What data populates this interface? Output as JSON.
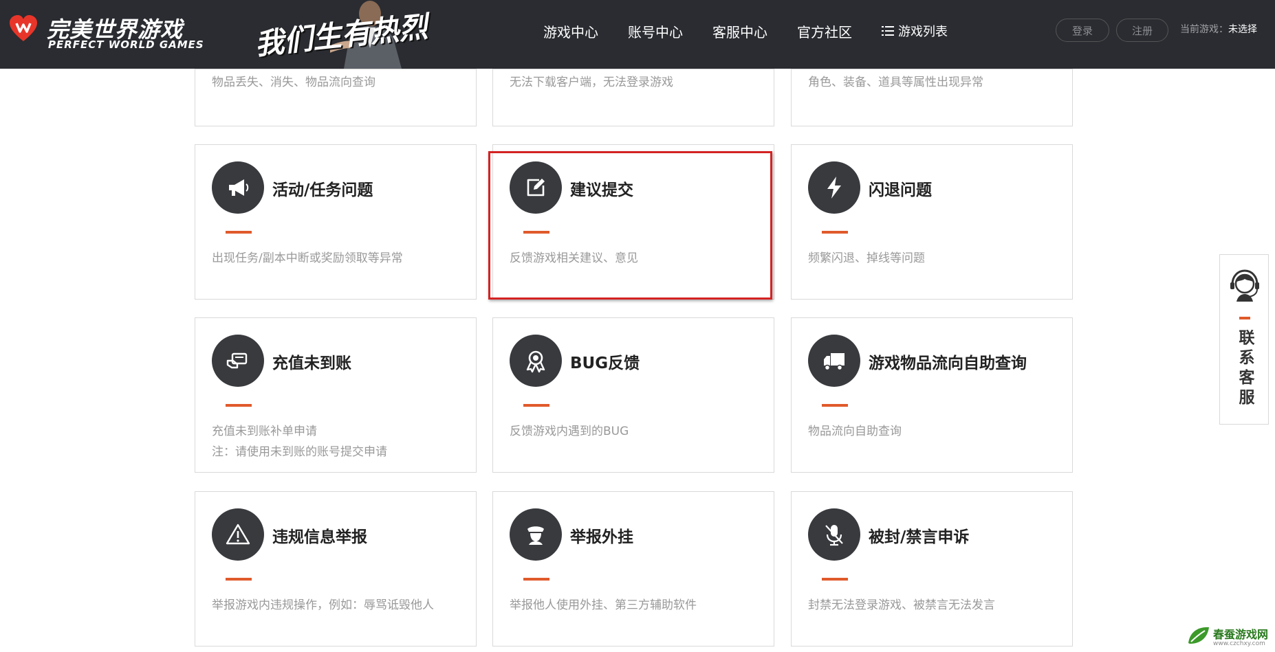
{
  "header": {
    "logo_cn": "完美世界游戏",
    "logo_en": "PERFECT WORLD GAMES",
    "banner_slogan": "我们生有热烈",
    "nav": [
      "游戏中心",
      "账号中心",
      "客服中心",
      "官方社区"
    ],
    "game_list": "游戏列表",
    "login": "登录",
    "register": "注册",
    "current_game_label": "当前游戏：",
    "current_game_value": "未选择"
  },
  "top_cards": [
    {
      "desc": "物品丢失、消失、物品流向查询"
    },
    {
      "desc": "无法下载客户端，无法登录游戏"
    },
    {
      "desc": "角色、装备、道具等属性出现异常"
    }
  ],
  "cards": [
    {
      "title": "活动/任务问题",
      "icon": "megaphone-icon",
      "desc": "出现任务/副本中断或奖励领取等异常",
      "desc2": ""
    },
    {
      "title": "建议提交",
      "icon": "edit-icon",
      "desc": "反馈游戏相关建议、意见",
      "desc2": ""
    },
    {
      "title": "闪退问题",
      "icon": "lightning-icon",
      "desc": "频繁闪退、掉线等问题",
      "desc2": ""
    },
    {
      "title": "充值未到账",
      "icon": "payment-icon",
      "desc": "充值未到账补单申请",
      "desc2": "注：请使用未到账的账号提交申请"
    },
    {
      "title": "BUG反馈",
      "icon": "badge-icon",
      "desc": "反馈游戏内遇到的BUG",
      "desc2": ""
    },
    {
      "title": "游戏物品流向自助查询",
      "icon": "truck-icon",
      "desc": "物品流向自助查询",
      "desc2": ""
    },
    {
      "title": "违规信息举报",
      "icon": "warning-icon",
      "desc": "举报游戏内违规操作，例如：辱骂诋毁他人",
      "desc2": ""
    },
    {
      "title": "举报外挂",
      "icon": "police-icon",
      "desc": "举报他人使用外挂、第三方辅助软件",
      "desc2": ""
    },
    {
      "title": "被封/禁言申诉",
      "icon": "mic-off-icon",
      "desc": "封禁无法登录游戏、被禁言无法发言",
      "desc2": ""
    }
  ],
  "side": {
    "label": "联系客服"
  },
  "watermark": {
    "name": "春蚕游戏网",
    "url": "www.czchxy.com"
  },
  "colors": {
    "header_bg": "#2a2c31",
    "accent": "#e05a2b",
    "icon_bg": "#383a3e",
    "highlight": "#d42222"
  }
}
